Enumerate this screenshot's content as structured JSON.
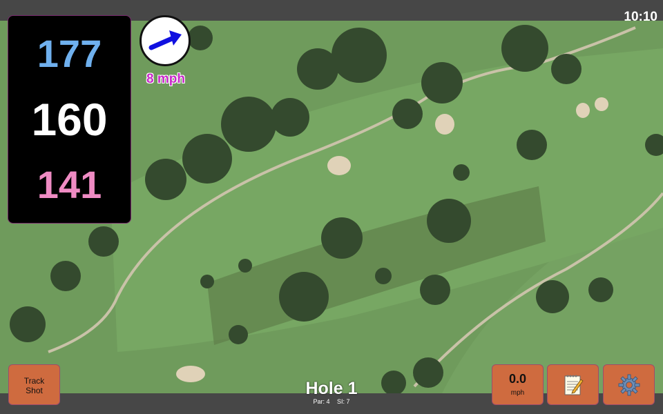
{
  "status": {
    "time": "10:10"
  },
  "distances": {
    "back": "177",
    "middle": "160",
    "front": "141"
  },
  "wind": {
    "label": "8 mph",
    "arrow_icon": "arrow-right-icon"
  },
  "buttons": {
    "track_shot_line1": "Track",
    "track_shot_line2": "Shot",
    "wind_value": "0.0",
    "wind_unit": "mph",
    "notes_icon": "notepad-icon",
    "settings_icon": "gear-icon"
  },
  "hole": {
    "title": "Hole 1",
    "par": "Par: 4",
    "si": "SI: 7"
  },
  "colors": {
    "back": "#6fb0ee",
    "middle": "#ffffff",
    "front": "#ef8bc3",
    "button": "#cf6b3f",
    "wind_text": "#c728c8"
  }
}
